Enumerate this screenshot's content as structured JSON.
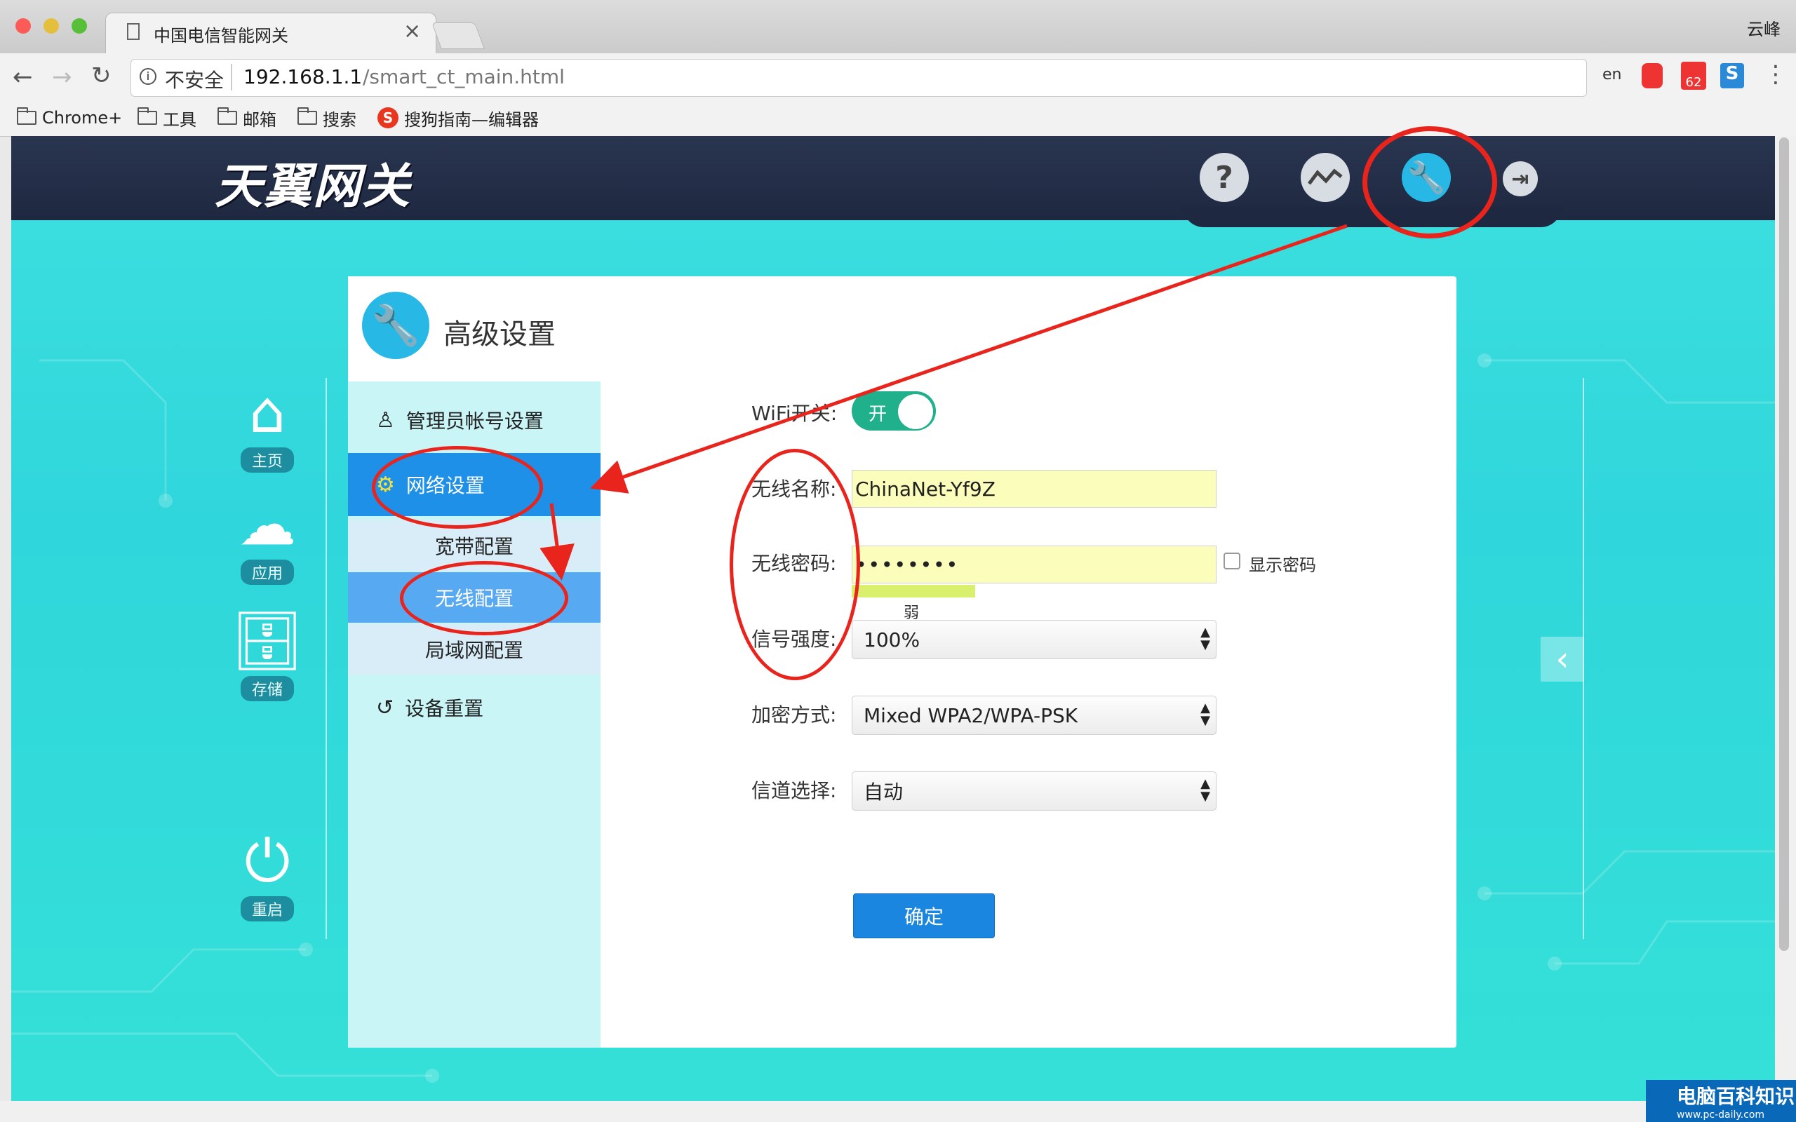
{
  "browser": {
    "tab_title": "中国电信智能网关",
    "tab_close": "×",
    "profile_name": "云峰",
    "security_label": "不安全",
    "url_host": "192.168.1.1",
    "url_path": "/smart_ct_main.html",
    "ext_badge": "62",
    "bookmarks": [
      {
        "label": "Chrome+"
      },
      {
        "label": "工具"
      },
      {
        "label": "邮箱"
      },
      {
        "label": "搜索"
      },
      {
        "label": "搜狗指南—编辑器"
      }
    ]
  },
  "app": {
    "logo": "天翼网关",
    "side_nav": [
      {
        "label": "主页",
        "icon": "home-icon"
      },
      {
        "label": "应用",
        "icon": "cloud-icon"
      },
      {
        "label": "存储",
        "icon": "storage-icon"
      },
      {
        "label": "重启",
        "icon": "power-icon"
      }
    ],
    "top_icons": [
      "help-icon",
      "stats-icon",
      "wrench-icon",
      "logout-icon"
    ]
  },
  "panel": {
    "title": "高级设置",
    "menu": {
      "admin": "管理员帐号设置",
      "network": "网络设置",
      "broadband": "宽带配置",
      "wireless": "无线配置",
      "lan": "局域网配置",
      "reset": "设备重置"
    },
    "form": {
      "wifi_switch_label": "WiFi开关:",
      "wifi_switch_value": "开",
      "ssid_label": "无线名称:",
      "ssid_value": "ChinaNet-Yf9Z",
      "password_label": "无线密码:",
      "password_value": "••••••••",
      "password_strength": "弱",
      "show_password_label": "显示密码",
      "signal_label": "信号强度:",
      "signal_value": "100%",
      "encryption_label": "加密方式:",
      "encryption_value": "Mixed WPA2/WPA-PSK",
      "channel_label": "信道选择:",
      "channel_value": "自动",
      "submit_label": "确定"
    }
  },
  "watermark": {
    "title": "电脑百科知识",
    "url": "www.pc-daily.com"
  },
  "colors": {
    "accent": "#1e90e8",
    "toggle_on": "#20b08b",
    "annotation": "#e8241c",
    "page_bg": "#35dbdc"
  }
}
